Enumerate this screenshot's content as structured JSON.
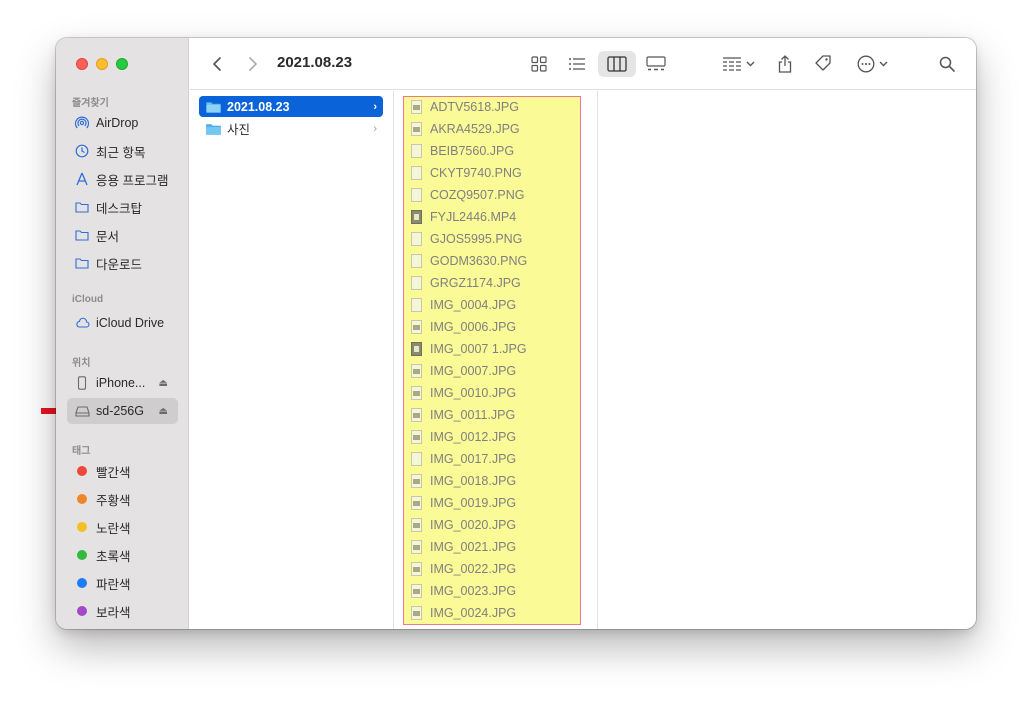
{
  "window": {
    "title": "2021.08.23"
  },
  "sidebar": {
    "favorites_label": "즐겨찾기",
    "favorites": [
      {
        "label": "AirDrop",
        "icon": "airdrop-icon"
      },
      {
        "label": "최근 항목",
        "icon": "clock-icon"
      },
      {
        "label": "응용 프로그램",
        "icon": "apps-icon"
      },
      {
        "label": "데스크탑",
        "icon": "folder-icon"
      },
      {
        "label": "문서",
        "icon": "folder-icon"
      },
      {
        "label": "다운로드",
        "icon": "folder-icon"
      }
    ],
    "icloud_label": "iCloud",
    "icloud": [
      {
        "label": "iCloud Drive",
        "icon": "cloud-icon"
      }
    ],
    "locations_label": "위치",
    "locations": [
      {
        "label": "iPhone...",
        "icon": "phone-icon",
        "eject": "⏏"
      },
      {
        "label": "sd-256G",
        "icon": "drive-icon",
        "eject": "⏏",
        "selected": true
      }
    ],
    "tags_label": "태그",
    "tags": [
      {
        "label": "빨간색",
        "color": "#f0453a"
      },
      {
        "label": "주황색",
        "color": "#f0852a"
      },
      {
        "label": "노란색",
        "color": "#f3c01f"
      },
      {
        "label": "초록색",
        "color": "#33b940"
      },
      {
        "label": "파란색",
        "color": "#1f7cf2"
      },
      {
        "label": "보라색",
        "color": "#a348c9"
      }
    ]
  },
  "column1": [
    {
      "label": "2021.08.23",
      "selected": true
    },
    {
      "label": "사진",
      "selected": false
    }
  ],
  "files": [
    {
      "name": "ADTV5618.JPG",
      "kind": "img"
    },
    {
      "name": "AKRA4529.JPG",
      "kind": "img"
    },
    {
      "name": "BEIB7560.JPG",
      "kind": "doc"
    },
    {
      "name": "CKYT9740.PNG",
      "kind": "doc"
    },
    {
      "name": "COZQ9507.PNG",
      "kind": "doc"
    },
    {
      "name": "FYJL2446.MP4",
      "kind": "vid"
    },
    {
      "name": "GJOS5995.PNG",
      "kind": "doc"
    },
    {
      "name": "GODM3630.PNG",
      "kind": "doc"
    },
    {
      "name": "GRGZ1174.JPG",
      "kind": "doc"
    },
    {
      "name": "IMG_0004.JPG",
      "kind": "doc"
    },
    {
      "name": "IMG_0006.JPG",
      "kind": "img"
    },
    {
      "name": "IMG_0007 1.JPG",
      "kind": "vid"
    },
    {
      "name": "IMG_0007.JPG",
      "kind": "img"
    },
    {
      "name": "IMG_0010.JPG",
      "kind": "img"
    },
    {
      "name": "IMG_0011.JPG",
      "kind": "img"
    },
    {
      "name": "IMG_0012.JPG",
      "kind": "img"
    },
    {
      "name": "IMG_0017.JPG",
      "kind": "doc"
    },
    {
      "name": "IMG_0018.JPG",
      "kind": "img"
    },
    {
      "name": "IMG_0019.JPG",
      "kind": "img"
    },
    {
      "name": "IMG_0020.JPG",
      "kind": "img"
    },
    {
      "name": "IMG_0021.JPG",
      "kind": "img"
    },
    {
      "name": "IMG_0022.JPG",
      "kind": "img"
    },
    {
      "name": "IMG_0023.JPG",
      "kind": "img"
    },
    {
      "name": "IMG_0024.JPG",
      "kind": "img"
    }
  ],
  "colors": {
    "selection": "#0a63d8",
    "highlight_fill": "#fafa96",
    "highlight_border": "#e87a8a",
    "annotation_arrow": "#e8141e"
  }
}
